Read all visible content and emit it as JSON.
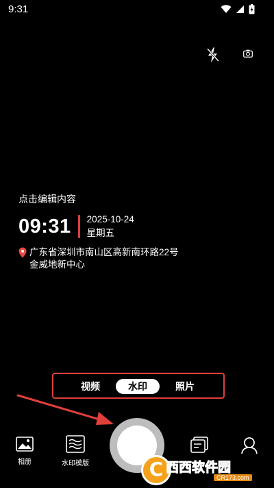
{
  "status_bar": {
    "time": "9:31",
    "icons": [
      "wifi-icon",
      "signal-icon",
      "battery-icon"
    ]
  },
  "top_controls": {
    "flash_icon": "flash-off-icon",
    "switch_icon": "camera-switch-icon"
  },
  "watermark": {
    "edit_hint": "点击编辑内容",
    "time": "09:31",
    "date": "2025-10-24",
    "weekday": "星期五",
    "address_line1": "广东省深圳市南山区高新南环路22号",
    "address_line2": "金威地新中心",
    "accent_color": "#d9423c"
  },
  "mode_switcher": {
    "tabs": [
      {
        "label": "视频",
        "selected": false
      },
      {
        "label": "水印",
        "selected": true
      },
      {
        "label": "照片",
        "selected": false
      }
    ]
  },
  "bottom_bar": {
    "album_label": "相册",
    "template_label": "水印模版",
    "shutter_icon": "shutter-button"
  },
  "site_watermark": {
    "name": "西西软件园",
    "url": "CR173.com"
  },
  "colors": {
    "highlight": "#e0403a",
    "background": "#000000"
  }
}
